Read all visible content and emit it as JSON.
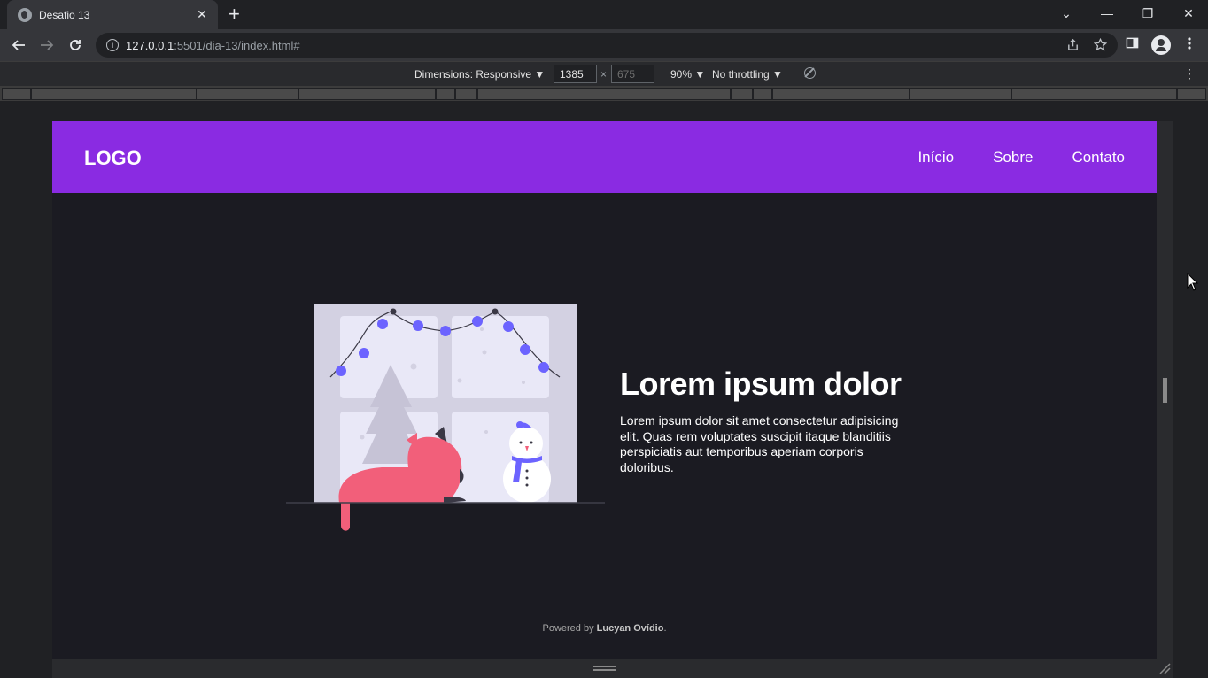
{
  "browser": {
    "tab_title": "Desafio 13",
    "tab_close": "✕",
    "new_tab": "+",
    "url_host": "127.0.0.1",
    "url_rest": ":5501/dia-13/index.html#",
    "window_controls": [
      "⌄",
      "—",
      "❐",
      "✕"
    ]
  },
  "devtools": {
    "dimensions_label": "Dimensions: Responsive ▼",
    "width": "1385",
    "height": "675",
    "times": "×",
    "zoom": "90% ▼",
    "throttling": "No throttling ▼"
  },
  "site": {
    "logo": "LOGO",
    "nav": [
      "Início",
      "Sobre",
      "Contato"
    ],
    "hero_title": "Lorem ipsum dolor",
    "hero_body": "Lorem ipsum dolor sit amet consectetur adipisicing elit. Quas rem voluptates suscipit itaque blanditiis perspiciatis aut temporibus aperiam corporis doloribus.",
    "footer_prefix": "Powered by ",
    "footer_author": "Lucyan Ovídio",
    "footer_suffix": "."
  },
  "colors": {
    "header_purple": "#8a2be2",
    "page_bg": "#1b1b22",
    "cat_pink": "#f25f7a",
    "light_bulb": "#6c63ff"
  }
}
